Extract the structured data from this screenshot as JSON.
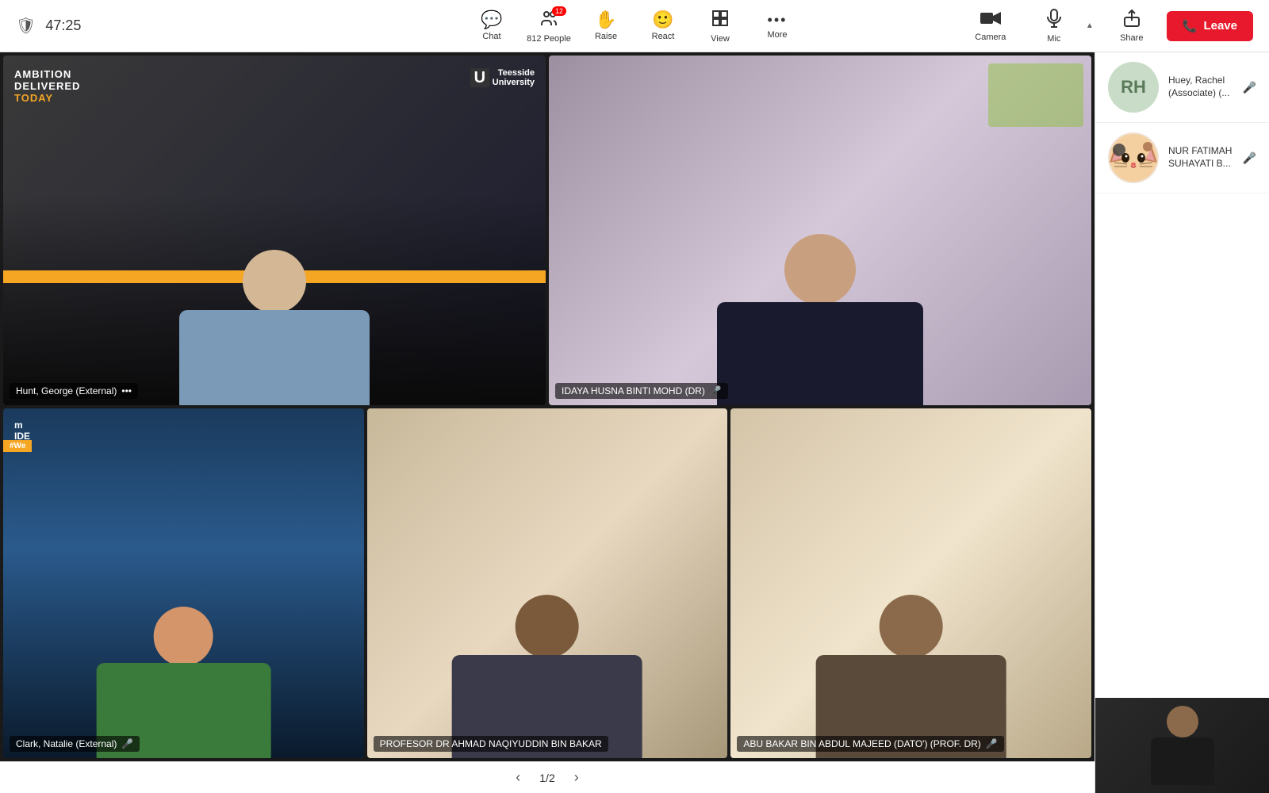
{
  "topbar": {
    "timer": "47:25",
    "buttons": [
      {
        "id": "chat",
        "label": "Chat",
        "icon": "💬",
        "badge": null
      },
      {
        "id": "people",
        "label": "People",
        "icon": "👤",
        "badge": "12"
      },
      {
        "id": "raise",
        "label": "Raise",
        "icon": "✋",
        "badge": null
      },
      {
        "id": "react",
        "label": "React",
        "icon": "😊",
        "badge": null
      },
      {
        "id": "view",
        "label": "View",
        "icon": "⊞",
        "badge": null
      },
      {
        "id": "more",
        "label": "More",
        "icon": "•••",
        "badge": null
      }
    ],
    "camera_label": "Camera",
    "mic_label": "Mic",
    "share_label": "Share",
    "leave_label": "Leave"
  },
  "participants": {
    "top_left": {
      "name": "Hunt, George (External)",
      "has_options": true
    },
    "top_right": {
      "name": "IDAYA HUSNA BINTI MOHD (DR)",
      "mic_off": true
    },
    "bottom_left": {
      "name": "Clark, Natalie (External)",
      "mic_off": true
    },
    "bottom_mid": {
      "name": "PROFESOR DR AHMAD NAQIYUDDIN BIN BAKAR",
      "mic_off": false
    },
    "bottom_right": {
      "name": "ABU BAKAR BIN ABDUL MAJEED (DATO') (PROF. DR)",
      "mic_off": true
    }
  },
  "sidebar": {
    "participant1": {
      "initials": "RH",
      "name": "Huey, Rachel (Associate) (...",
      "mic_off": true
    },
    "participant2": {
      "avatar_emoji": "🐱",
      "name": "NUR FATIMAH SUHAYATI B...",
      "mic_off": true
    }
  },
  "pagination": {
    "current": "1",
    "total": "2",
    "label": "1/2"
  },
  "hunt_overlay": {
    "line1": "AMBITION",
    "line2": "DELIVERED",
    "line3": "TODAY",
    "university": "U Teesside\nUniversity"
  },
  "clark_overlay": {
    "line1": "#We",
    "side": "IDE"
  }
}
